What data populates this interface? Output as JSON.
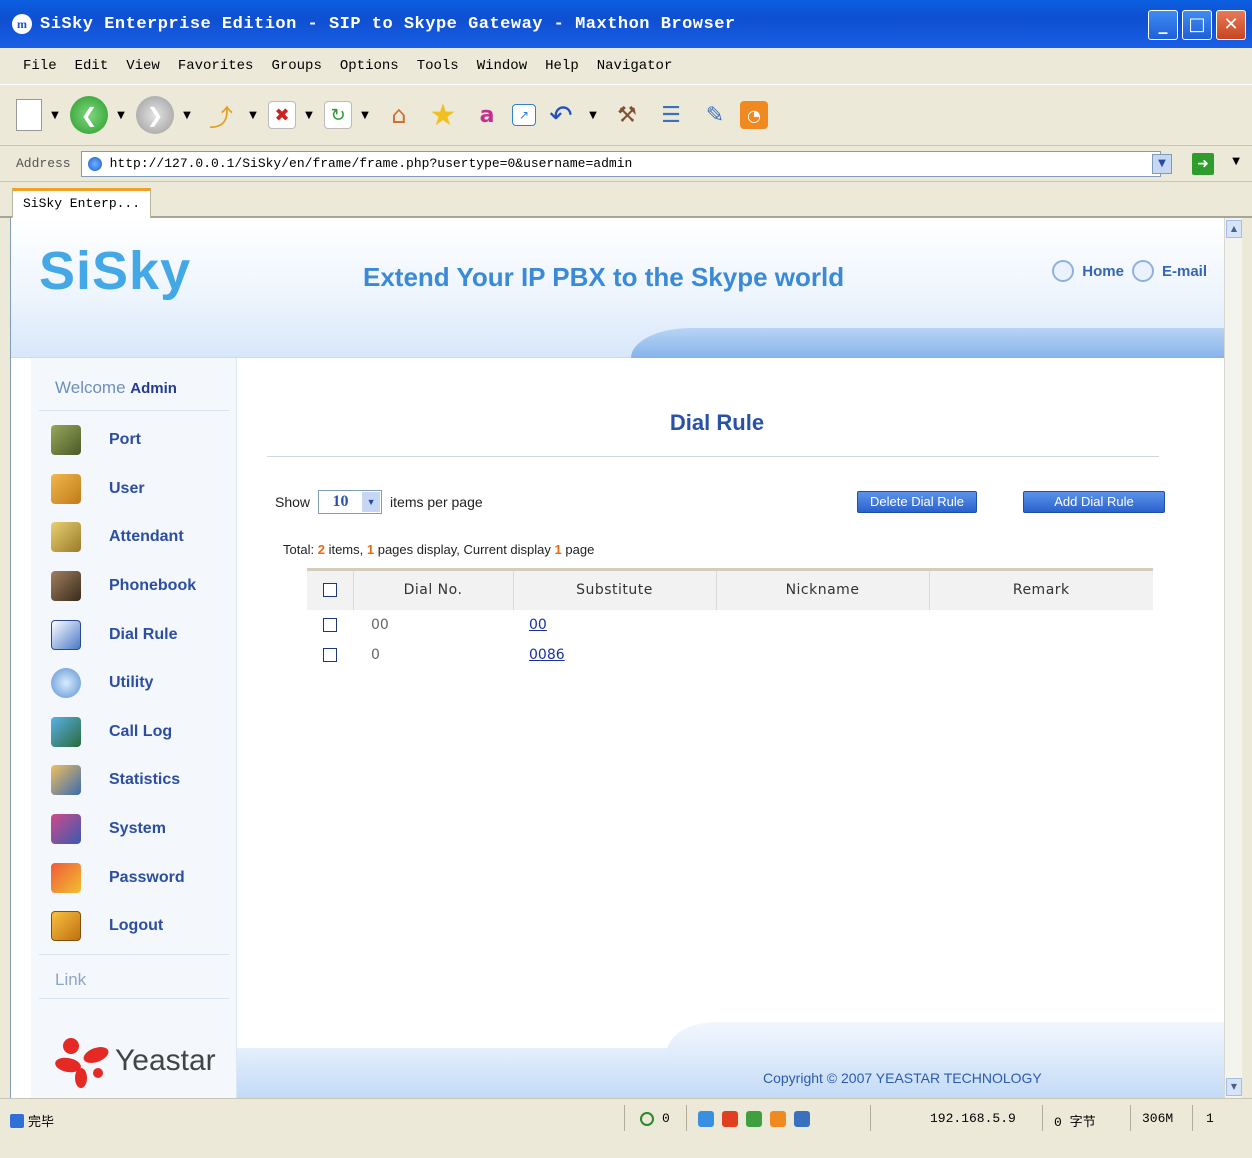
{
  "window": {
    "title": "SiSky Enterprise Edition - SIP to Skype Gateway - Maxthon Browser",
    "app_icon": "m",
    "buttons": {
      "minimize": "_",
      "maximize": "□",
      "close": "✕"
    }
  },
  "menubar": {
    "items": [
      {
        "label": "File"
      },
      {
        "label": "Edit"
      },
      {
        "label": "View"
      },
      {
        "label": "Favorites"
      },
      {
        "label": "Groups"
      },
      {
        "label": "Options"
      },
      {
        "label": "Tools"
      },
      {
        "label": "Window"
      },
      {
        "label": "Help"
      },
      {
        "label": "Navigator"
      }
    ]
  },
  "toolbar": {
    "icons": [
      "new-page-icon",
      "back-icon",
      "forward-icon",
      "up-icon",
      "stop-icon",
      "refresh-icon",
      "home-icon",
      "favorites-star-icon",
      "translate-icon",
      "restore-icon",
      "undo-icon",
      "tools-icon",
      "list-icon",
      "edit-icon",
      "rss-icon"
    ]
  },
  "address": {
    "label": "Address",
    "url": "http://127.0.0.1/SiSky/en/frame/frame.php?usertype=0&username=admin"
  },
  "tabs": [
    {
      "label": "SiSky Enterp..."
    }
  ],
  "header": {
    "logo": "SiSky",
    "tagline": "Extend Your IP PBX to the Skype world",
    "links": {
      "home": "Home",
      "email": "E-mail"
    }
  },
  "sidebar": {
    "welcome": "Welcome",
    "user": "Admin",
    "items": [
      {
        "label": "Port",
        "icon": "port-icon",
        "color": "#6b7a3a"
      },
      {
        "label": "User",
        "icon": "users-icon",
        "color": "#d49a2c"
      },
      {
        "label": "Attendant",
        "icon": "attendant-icon",
        "color": "#c9a64a"
      },
      {
        "label": "Phonebook",
        "icon": "phonebook-icon",
        "color": "#5a4a3a"
      },
      {
        "label": "Dial Rule",
        "icon": "dial-rule-icon",
        "color": "#4a78c8"
      },
      {
        "label": "Utility",
        "icon": "utility-icon",
        "color": "#6da0d8"
      },
      {
        "label": "Call Log",
        "icon": "call-log-icon",
        "color": "#3f8fc8"
      },
      {
        "label": "Statistics",
        "icon": "statistics-icon",
        "color": "#c89a3a"
      },
      {
        "label": "System",
        "icon": "system-icon",
        "color": "#b03a6a"
      },
      {
        "label": "Password",
        "icon": "password-icon",
        "color": "#d03a2a"
      },
      {
        "label": "Logout",
        "icon": "logout-icon",
        "color": "#e0a030"
      }
    ],
    "link_header": "Link",
    "partner": "Yeastar"
  },
  "main": {
    "title": "Dial Rule",
    "show_label": "Show",
    "per_page": "10",
    "per_page_suffix": "items per page",
    "delete_button": "Delete Dial Rule",
    "add_button": "Add Dial Rule",
    "total": {
      "prefix": "Total:",
      "items": "2",
      "items_label": "items,",
      "pages": "1",
      "pages_label": "pages display, Current display",
      "current": "1",
      "current_label": "page"
    },
    "columns": [
      "Dial No.",
      "Substitute",
      "Nickname",
      "Remark"
    ],
    "rows": [
      {
        "dial_no": "00",
        "substitute": "00",
        "nickname": "",
        "remark": ""
      },
      {
        "dial_no": "0",
        "substitute": "0086",
        "nickname": "",
        "remark": ""
      }
    ]
  },
  "footer": {
    "copyright": "Copyright © 2007 YEASTAR TECHNOLOGY"
  },
  "statusbar": {
    "status": "完毕",
    "counter": "0",
    "ip": "192.168.5.9",
    "bytes": "0 字节",
    "memory": "306M",
    "number": "1"
  },
  "colors": {
    "accent": "#2851a8",
    "orange": "#e86a10",
    "titlebar": "#0f4fd1"
  }
}
